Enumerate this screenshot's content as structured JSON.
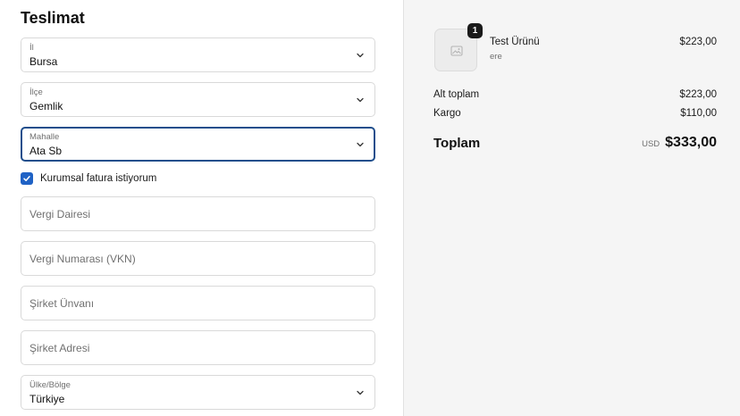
{
  "checkout": {
    "section_title": "Teslimat",
    "fields": {
      "il": {
        "label": "İl",
        "value": "Bursa"
      },
      "ilce": {
        "label": "İlçe",
        "value": "Gemlik"
      },
      "mahalle": {
        "label": "Mahalle",
        "value": "Ata Sb"
      },
      "vergi_dairesi": {
        "placeholder": "Vergi Dairesi"
      },
      "vergi_numarasi": {
        "placeholder": "Vergi Numarası (VKN)"
      },
      "sirket_unvani": {
        "placeholder": "Şirket Ünvanı"
      },
      "sirket_adresi": {
        "placeholder": "Şirket Adresi"
      },
      "ulke": {
        "label": "Ülke/Bölge",
        "value": "Türkiye"
      }
    },
    "corporate_invoice": {
      "label": "Kurumsal fatura istiyorum",
      "checked": true
    }
  },
  "summary": {
    "product": {
      "name": "Test Ürünü",
      "variant": "ere",
      "price": "$223,00",
      "quantity": "1"
    },
    "subtotal": {
      "label": "Alt toplam",
      "value": "$223,00"
    },
    "shipping": {
      "label": "Kargo",
      "value": "$110,00"
    },
    "total": {
      "label": "Toplam",
      "currency": "USD",
      "value": "$333,00"
    }
  },
  "colors": {
    "accent": "#1f62c5",
    "focus_border": "#1f4e8c",
    "sidebar_bg": "#f5f5f5"
  },
  "icons": {
    "select": "chevron-down-icon",
    "checkbox": "check-icon",
    "thumbnail": "image-placeholder-icon"
  }
}
